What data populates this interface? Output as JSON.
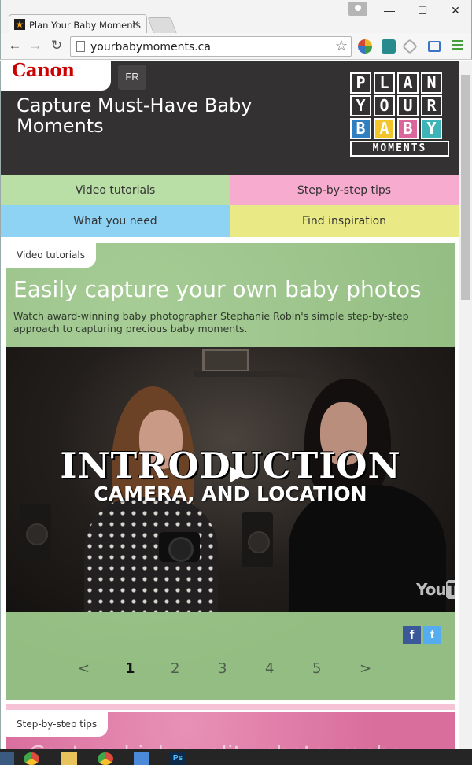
{
  "browser": {
    "tab_title": "Plan Your Baby Moments",
    "tab_close": "✕",
    "url": "yourbabymoments.ca",
    "window_controls": {
      "minimize": "—",
      "maximize": "☐",
      "close": "✕"
    },
    "nav": {
      "back": "←",
      "forward": "→",
      "reload": "↻"
    },
    "star": "☆",
    "icons": [
      "page-icon",
      "star-icon",
      "extension-icons",
      "menu-icon"
    ]
  },
  "header": {
    "brand": "Canon",
    "lang_toggle": "FR",
    "title": "Capture Must-Have Baby Moments",
    "logo_blocks": {
      "row1": [
        "P",
        "L",
        "A",
        "N"
      ],
      "row2": [
        "Y",
        "O",
        "U",
        "R"
      ],
      "row3": [
        "B",
        "A",
        "B",
        "Y"
      ],
      "row4": "MOMENTS"
    },
    "colors": {
      "background": "#333132",
      "brand_red": "#cc0000"
    }
  },
  "nav_tiles": [
    {
      "label": "Video tutorials",
      "color": "#b9dfa6"
    },
    {
      "label": "Step-by-step tips",
      "color": "#f6abcf"
    },
    {
      "label": "What you need",
      "color": "#8ed3f4"
    },
    {
      "label": "Find inspiration",
      "color": "#e9ea86"
    }
  ],
  "video_section": {
    "label": "Video tutorials",
    "heading": "Easily capture your own baby photos",
    "description": "Watch award-winning baby photographer Stephanie Robin's simple step-by-step approach to capturing precious baby moments.",
    "video": {
      "title": "INTRODUCTION",
      "subtitle": "CAMERA, AND LOCATION",
      "youtube_logo": "You",
      "youtube_logo_box": "Tube"
    },
    "share": {
      "facebook": "f",
      "twitter": "t"
    },
    "pager": {
      "prev": "<",
      "pages": [
        "1",
        "2",
        "3",
        "4",
        "5"
      ],
      "active_page": "1",
      "next": ">"
    }
  },
  "steps_section": {
    "label": "Step-by-step tips",
    "heading": "Capture high-quality photographs"
  },
  "taskbar": {
    "ps_label": "Ps"
  }
}
